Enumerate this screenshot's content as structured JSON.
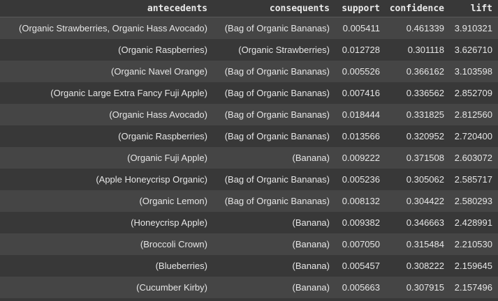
{
  "table": {
    "columns": [
      "antecedents",
      "consequents",
      "support",
      "confidence",
      "lift"
    ],
    "rows": [
      [
        "(Organic Strawberries, Organic Hass Avocado)",
        "(Bag of Organic Bananas)",
        "0.005411",
        "0.461339",
        "3.910321"
      ],
      [
        "(Organic Raspberries)",
        "(Organic Strawberries)",
        "0.012728",
        "0.301118",
        "3.626710"
      ],
      [
        "(Organic Navel Orange)",
        "(Bag of Organic Bananas)",
        "0.005526",
        "0.366162",
        "3.103598"
      ],
      [
        "(Organic Large Extra Fancy Fuji Apple)",
        "(Bag of Organic Bananas)",
        "0.007416",
        "0.336562",
        "2.852709"
      ],
      [
        "(Organic Hass Avocado)",
        "(Bag of Organic Bananas)",
        "0.018444",
        "0.331825",
        "2.812560"
      ],
      [
        "(Organic Raspberries)",
        "(Bag of Organic Bananas)",
        "0.013566",
        "0.320952",
        "2.720400"
      ],
      [
        "(Organic Fuji Apple)",
        "(Banana)",
        "0.009222",
        "0.371508",
        "2.603072"
      ],
      [
        "(Apple Honeycrisp Organic)",
        "(Bag of Organic Bananas)",
        "0.005236",
        "0.305062",
        "2.585717"
      ],
      [
        "(Organic Lemon)",
        "(Bag of Organic Bananas)",
        "0.008132",
        "0.304422",
        "2.580293"
      ],
      [
        "(Honeycrisp Apple)",
        "(Banana)",
        "0.009382",
        "0.346663",
        "2.428991"
      ],
      [
        "(Broccoli Crown)",
        "(Banana)",
        "0.007050",
        "0.315484",
        "2.210530"
      ],
      [
        "(Blueberries)",
        "(Banana)",
        "0.005457",
        "0.308222",
        "2.159645"
      ],
      [
        "(Cucumber Kirby)",
        "(Banana)",
        "0.005663",
        "0.307915",
        "2.157496"
      ]
    ]
  }
}
